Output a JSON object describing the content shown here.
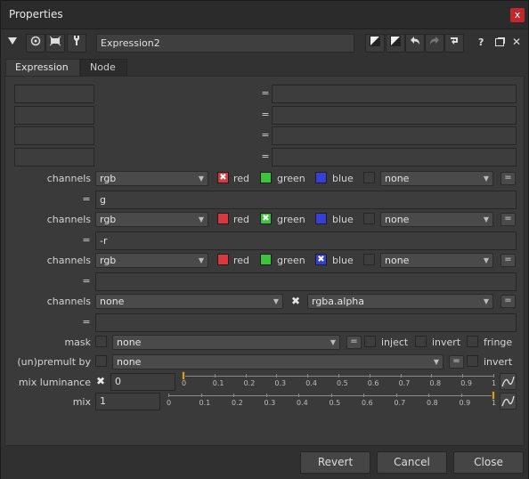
{
  "window": {
    "title": "Properties",
    "close_symbol": "x"
  },
  "toolbar": {
    "node_name": "Expression2"
  },
  "tabs": [
    {
      "label": "Expression"
    },
    {
      "label": "Node"
    }
  ],
  "temp_rows": [
    {
      "name": "",
      "value": ""
    },
    {
      "name": "",
      "value": ""
    },
    {
      "name": "",
      "value": ""
    },
    {
      "name": "",
      "value": ""
    }
  ],
  "eq": "=",
  "channels_label": "channels",
  "rgb_channels": [
    {
      "layer": "rgb",
      "red": "red",
      "green": "green",
      "blue": "blue",
      "extra": "none",
      "expr": "g",
      "checked": "red"
    },
    {
      "layer": "rgb",
      "red": "red",
      "green": "green",
      "blue": "blue",
      "extra": "none",
      "expr": "-r",
      "checked": "green"
    },
    {
      "layer": "rgb",
      "red": "red",
      "green": "green",
      "blue": "blue",
      "extra": "none",
      "expr": "",
      "checked": "blue"
    }
  ],
  "alpha_channel": {
    "layer": "none",
    "channel": "rgba.alpha",
    "expr": ""
  },
  "mask": {
    "label": "mask",
    "value": "none",
    "inject": "inject",
    "invert": "invert",
    "fringe": "fringe"
  },
  "premult": {
    "label": "(un)premult by",
    "value": "none",
    "invert": "invert"
  },
  "mix_luminance": {
    "label": "mix luminance",
    "value": "0",
    "fraction": 0
  },
  "mix": {
    "label": "mix",
    "value": "1",
    "fraction": 1
  },
  "slider_ticks_lum": [
    "0",
    "0.1",
    "0.2",
    "0.3",
    "0.4",
    "0.5",
    "0.6",
    "0.7",
    "0.8",
    "0.9",
    "1"
  ],
  "slider_ticks_mix": [
    "0",
    "0.1",
    "0.2",
    "0.3",
    "0.4",
    "0.5",
    "0.6",
    "0.7",
    "0.8",
    "0.9",
    "1"
  ],
  "buttons": {
    "revert": "Revert",
    "cancel": "Cancel",
    "close": "Close"
  },
  "colors": {
    "red": "#d8393e",
    "green": "#3cc43c",
    "blue": "#3a3ed8",
    "close_red": "#c0282d"
  }
}
